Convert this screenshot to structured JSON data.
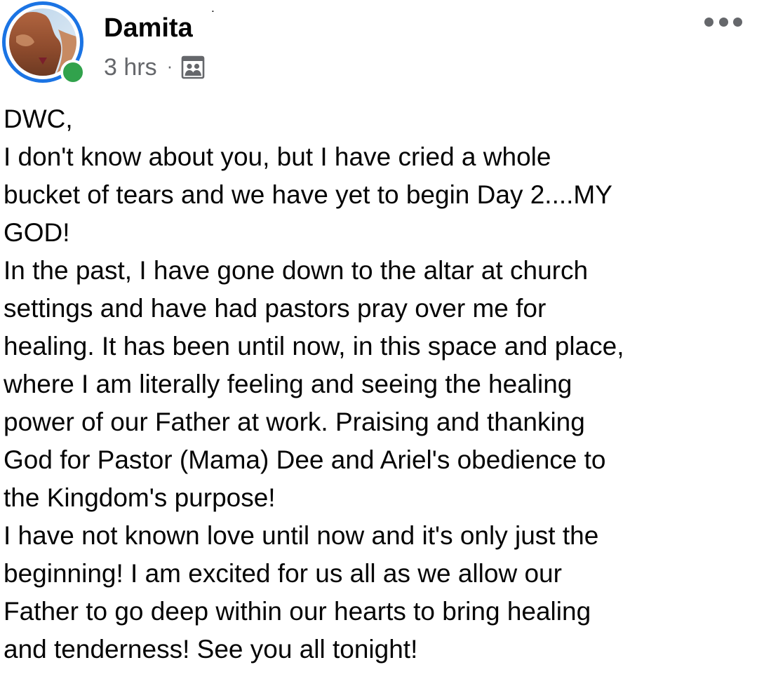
{
  "post": {
    "author": "Damita",
    "author_suffix": "˙",
    "timestamp": "3 hrs",
    "separator": "·",
    "audience_icon": "group-members-icon",
    "more_icon": "more-options-icon",
    "avatar_online": true,
    "colors": {
      "ring": "#1b74e4",
      "online": "#31a24c",
      "secondary_text": "#65676b",
      "primary_text": "#050505"
    },
    "body": "DWC,\nI don't know about you, but I have cried a whole\nbucket of tears and we have yet to begin Day 2....MY\nGOD!\nIn the past, I have gone down to the altar at church\nsettings and have had pastors pray over me for\nhealing. It has been until now, in this space and place,\nwhere I am literally feeling and seeing the healing\npower of our Father at work. Praising and thanking\nGod for Pastor (Mama) Dee and Ariel's obedience to\nthe Kingdom's purpose!\nI have not known love until now and it's only just the\nbeginning! I am excited for us all as we allow our\nFather to go deep within our hearts to bring healing\nand tenderness! See you all tonight!"
  }
}
